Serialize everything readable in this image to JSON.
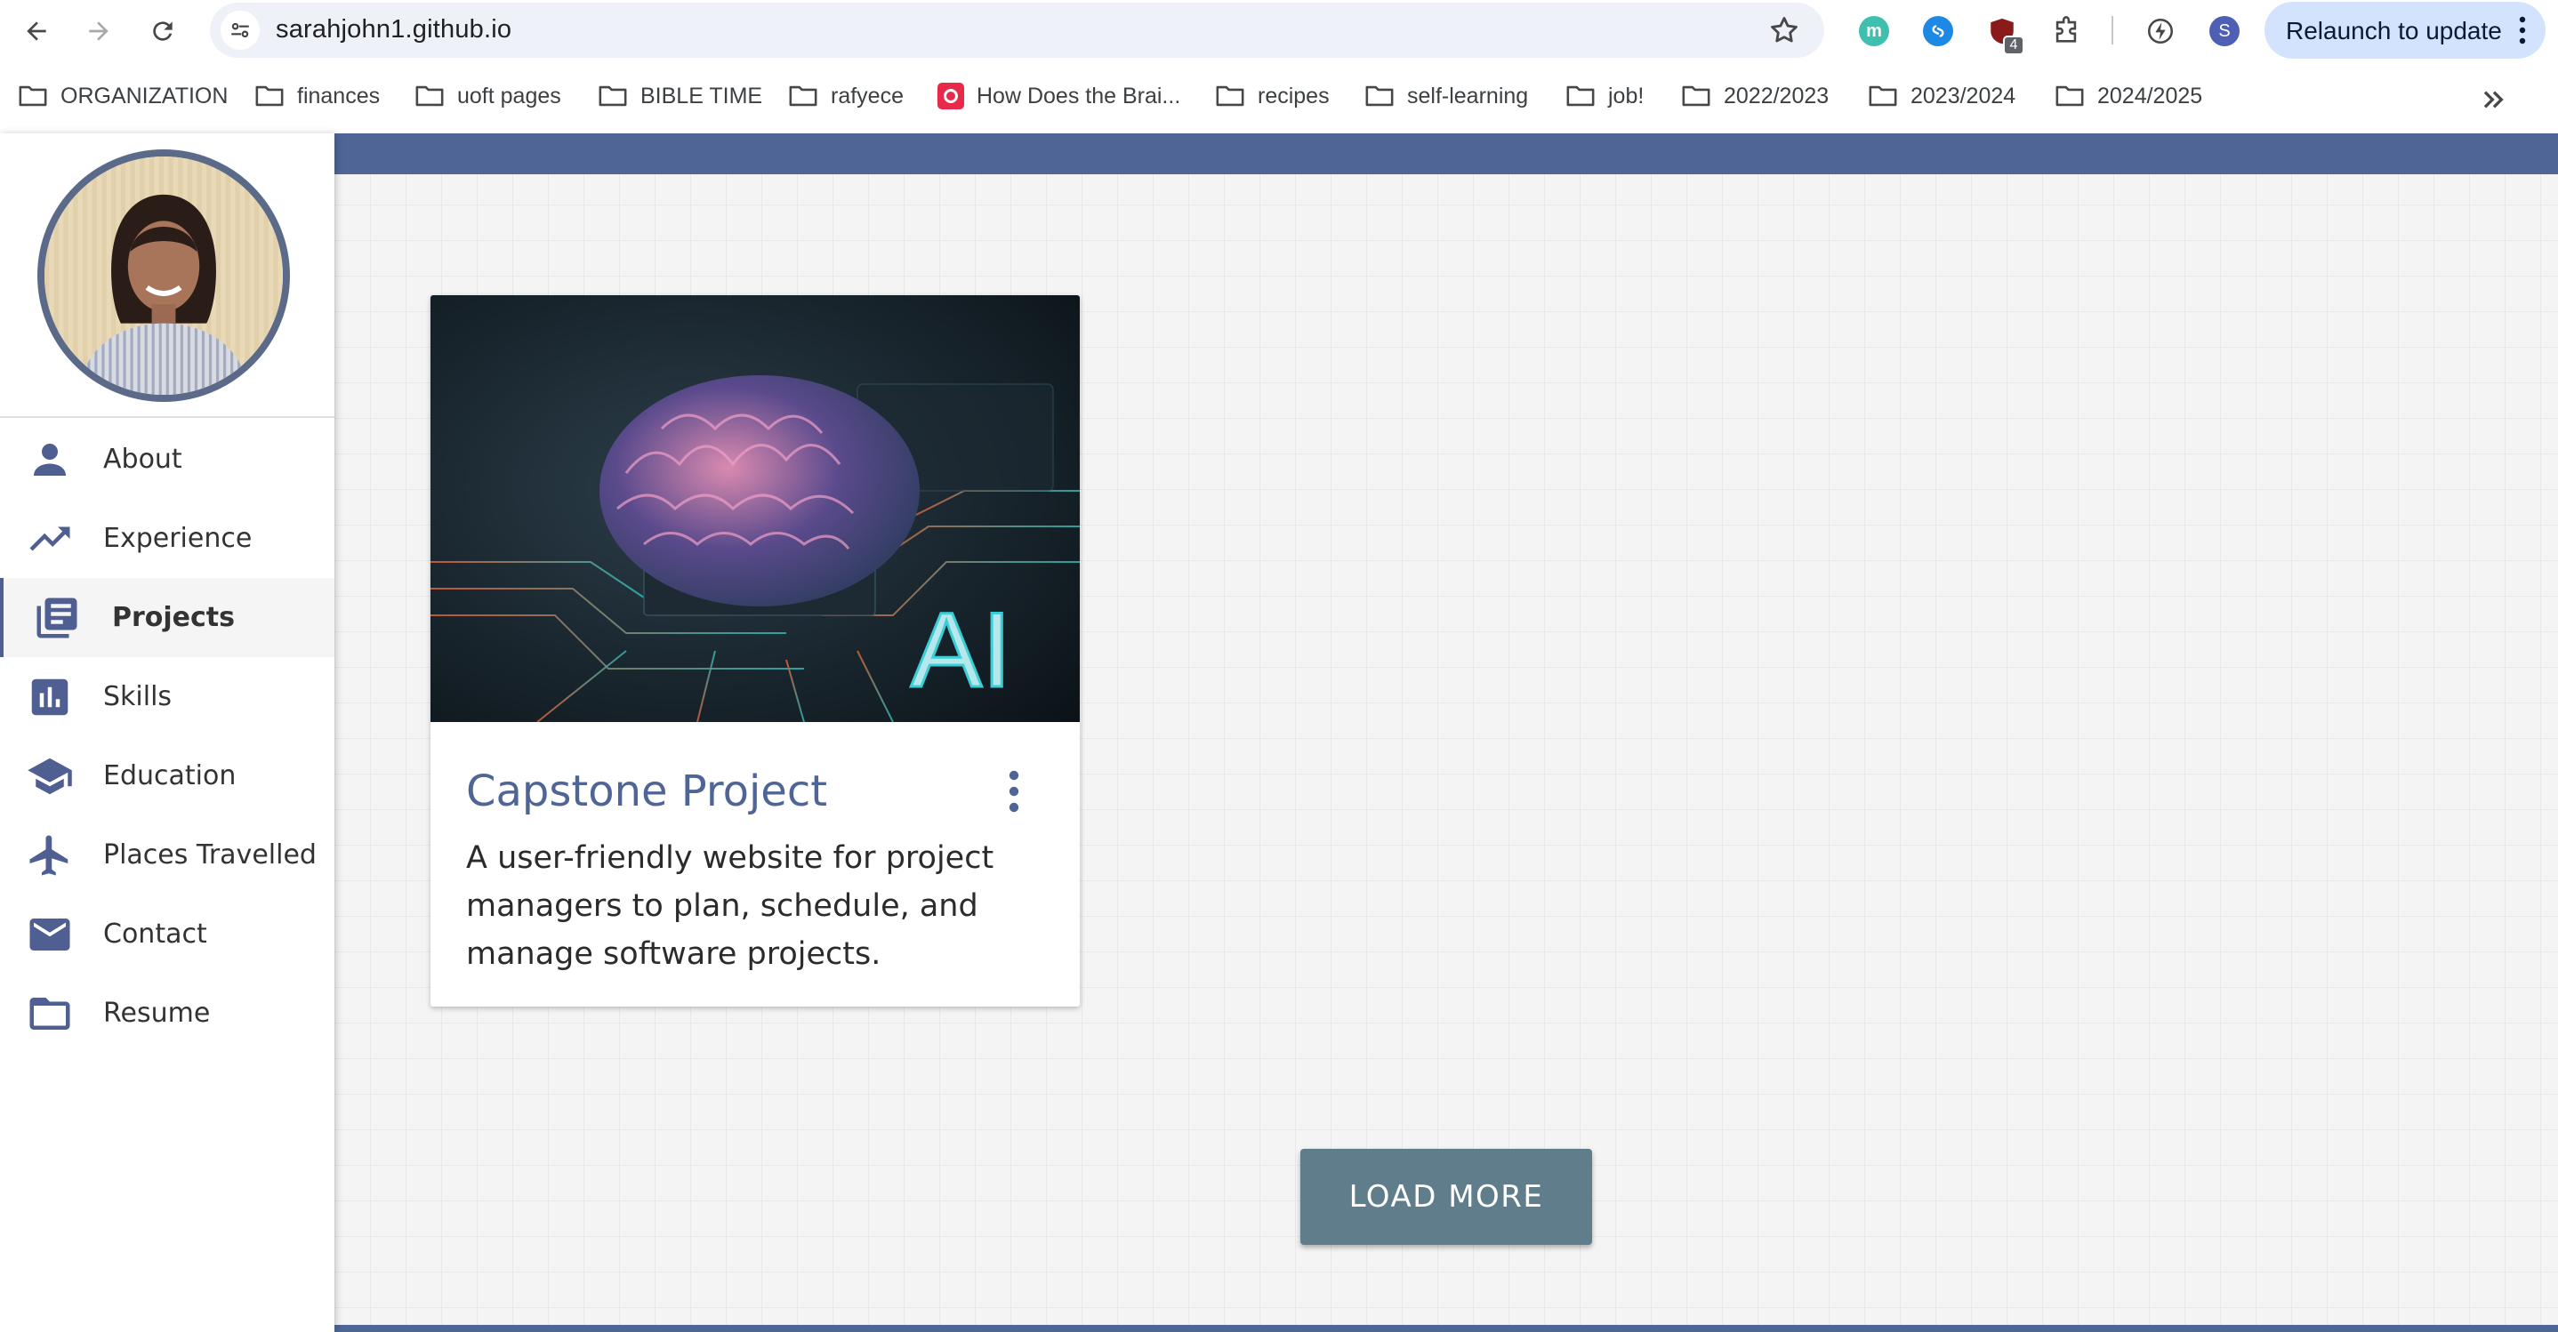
{
  "browser": {
    "url": "sarahjohn1.github.io",
    "relaunch_label": "Relaunch to update",
    "profile_initial": "S",
    "ext_m_letter": "m",
    "ext_badge_count": "4",
    "colors": {
      "relaunch_bg": "#d3e3fd",
      "omnibox_bg": "#eef1f8"
    }
  },
  "bookmarks": [
    {
      "label": "ORGANIZATION",
      "icon": "folder-icon"
    },
    {
      "label": "finances",
      "icon": "folder-icon"
    },
    {
      "label": "uoft pages",
      "icon": "folder-icon"
    },
    {
      "label": "BIBLE TIME",
      "icon": "folder-icon"
    },
    {
      "label": "rafyece",
      "icon": "folder-icon"
    },
    {
      "label": "How Does the Brai...",
      "icon": "quizlet-favicon"
    },
    {
      "label": "recipes",
      "icon": "folder-icon"
    },
    {
      "label": "self-learning",
      "icon": "folder-icon"
    },
    {
      "label": "job!",
      "icon": "folder-icon"
    },
    {
      "label": "2022/2023",
      "icon": "folder-icon"
    },
    {
      "label": "2023/2024",
      "icon": "folder-icon"
    },
    {
      "label": "2024/2025",
      "icon": "folder-icon"
    }
  ],
  "sidebar": {
    "items": [
      {
        "label": "About",
        "icon": "person-icon",
        "active": false
      },
      {
        "label": "Experience",
        "icon": "trending-up-icon",
        "active": false
      },
      {
        "label": "Projects",
        "icon": "library-books-icon",
        "active": true
      },
      {
        "label": "Skills",
        "icon": "bar-chart-icon",
        "active": false
      },
      {
        "label": "Education",
        "icon": "school-icon",
        "active": false
      },
      {
        "label": "Places Travelled",
        "icon": "airplane-icon",
        "active": false
      },
      {
        "label": "Contact",
        "icon": "email-icon",
        "active": false
      },
      {
        "label": "Resume",
        "icon": "folder-icon",
        "active": false
      }
    ]
  },
  "main": {
    "card": {
      "title": "Capstone Project",
      "description": "A user-friendly website for project managers to plan, schedule, and manage software projects.",
      "image_text": "AI"
    },
    "load_more_label": "LOAD MORE",
    "colors": {
      "accent": "#4f6596",
      "button": "#607d8b"
    }
  }
}
